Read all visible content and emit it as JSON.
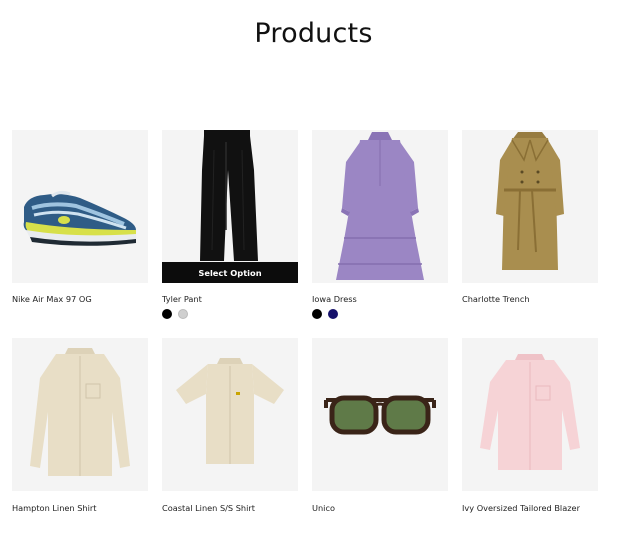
{
  "page": {
    "title": "Products"
  },
  "products": [
    {
      "name": "Nike Air Max 97 OG",
      "icon": "sneaker-image"
    },
    {
      "name": "Tyler Pant",
      "icon": "black-pants-image",
      "select_label": "Select Option",
      "swatches": [
        {
          "color": "#000000"
        },
        {
          "color": "#cfcfcf"
        }
      ]
    },
    {
      "name": "Iowa Dress",
      "icon": "purple-dress-image",
      "swatches": [
        {
          "color": "#000000"
        },
        {
          "color": "#15106b"
        }
      ]
    },
    {
      "name": "Charlotte Trench",
      "icon": "trench-coat-image"
    },
    {
      "name": "Hampton Linen Shirt",
      "icon": "linen-shirt-image"
    },
    {
      "name": "Coastal Linen S/S Shirt",
      "icon": "short-sleeve-shirt-image"
    },
    {
      "name": "Unico",
      "icon": "sunglasses-image"
    },
    {
      "name": "Ivy Oversized Tailored Blazer",
      "icon": "pink-shirt-image"
    }
  ],
  "colors": {
    "thumb_bg": "#f4f4f4",
    "select_button_bg": "#0c0c0c",
    "dress": "#9b86c4",
    "trench": "#a98e4f",
    "linen": "#e8dec6",
    "pink": "#f6d3d6",
    "lens": "#5f7a48"
  }
}
